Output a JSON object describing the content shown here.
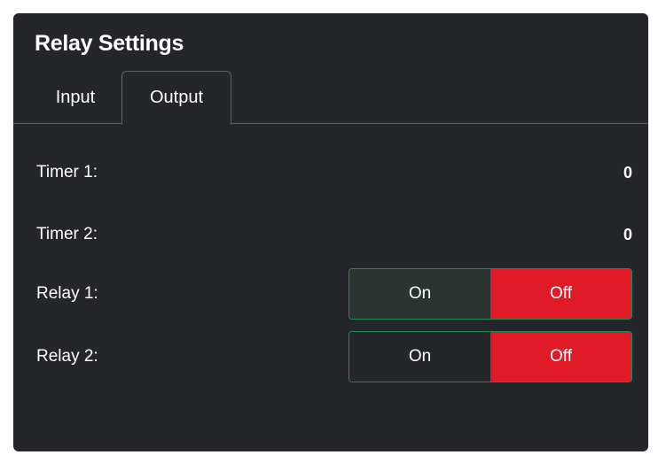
{
  "panel": {
    "title": "Relay Settings",
    "tabs": [
      {
        "label": "Input",
        "active": false
      },
      {
        "label": "Output",
        "active": true
      }
    ]
  },
  "rows": {
    "timer1": {
      "label": "Timer 1:",
      "value": "0"
    },
    "timer2": {
      "label": "Timer 2:",
      "value": "0"
    },
    "relay1": {
      "label": "Relay 1:",
      "on_label": "On",
      "off_label": "Off",
      "selected": "Off"
    },
    "relay2": {
      "label": "Relay 2:",
      "on_label": "On",
      "off_label": "Off",
      "selected": "Off"
    }
  },
  "colors": {
    "panel_bg": "#24262a",
    "off_active": "#e11a27",
    "toggle_border": "#1f8a55",
    "tab_border": "#5d6066"
  }
}
